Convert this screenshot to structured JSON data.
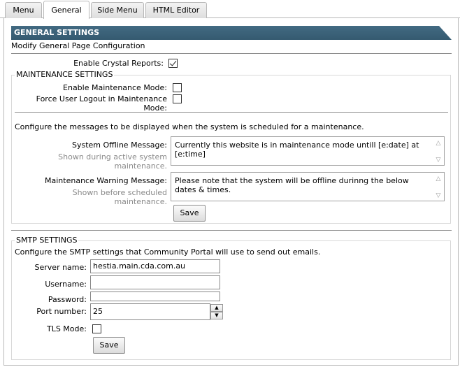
{
  "tabs": [
    {
      "label": "Menu"
    },
    {
      "label": "General"
    },
    {
      "label": "Side Menu"
    },
    {
      "label": "HTML Editor"
    }
  ],
  "general": {
    "header": "GENERAL SETTINGS",
    "subtitle": "Modify General Page Configuration",
    "crystal_label": "Enable Crystal Reports:",
    "crystal_checked": true
  },
  "maintenance": {
    "legend": "MAINTENANCE SETTINGS",
    "enable_label": "Enable Maintenance Mode:",
    "force_label": "Force User Logout in Maintenance Mode:",
    "description": "Configure the messages to be displayed when the system is scheduled for a maintenance.",
    "offline_label": "System Offline Message:",
    "offline_hint": "Shown during active system maintenance.",
    "offline_value": "Currently this website is in maintenance mode untill [e:date] at [e:time]",
    "warning_label": "Maintenance Warning Message:",
    "warning_hint": "Shown before scheduled maintenance.",
    "warning_value": "Please note that the system will be offline durinng the below dates & times.",
    "save_label": "Save"
  },
  "smtp": {
    "legend": "SMTP SETTINGS",
    "description": "Configure the SMTP settings that Community Portal will use to send out emails.",
    "server_label": "Server name:",
    "server_value": "hestia.main.cda.com.au",
    "username_label": "Username:",
    "username_value": "",
    "password_label": "Password:",
    "port_label": "Port number:",
    "port_value": "25",
    "tls_label": "TLS Mode:",
    "save_label": "Save"
  },
  "icons": {
    "checkbox_checked": "check-mark",
    "scroll_up": "chevron-up-icon",
    "scroll_down": "chevron-down-icon"
  },
  "colors": {
    "header_bg": "#3d6379",
    "hint_text": "#8a8a8a"
  }
}
